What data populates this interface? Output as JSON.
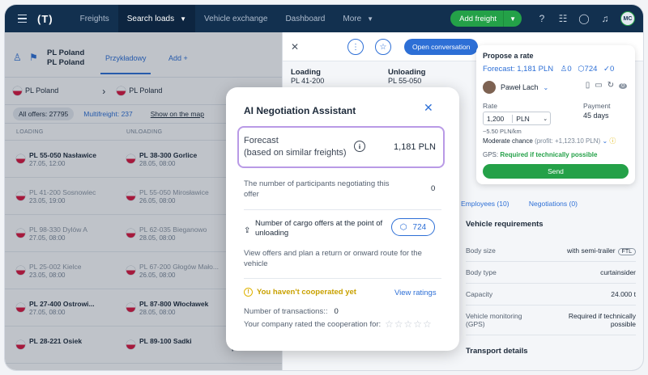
{
  "topnav": {
    "logo": "(T)",
    "items": [
      {
        "label": "Freights",
        "active": false
      },
      {
        "label": "Search loads",
        "active": true
      },
      {
        "label": "Vehicle exchange",
        "active": false
      },
      {
        "label": "Dashboard",
        "active": false
      },
      {
        "label": "More",
        "active": false
      }
    ],
    "add_freight": "Add freight",
    "avatar_initials": "MC"
  },
  "left_panel": {
    "route_from": "PL Poland",
    "route_to": "PL Poland",
    "tab_example": "Przykładowy",
    "tab_add": "Add +",
    "filter_from": "PL Poland",
    "filter_to": "PL Poland",
    "all_offers": "All offers: 27795",
    "multifreight": "Multifreight: 237",
    "show_map": "Show on the map",
    "col_loading": "LOADING",
    "col_unloading": "UNLOADING",
    "rows": [
      {
        "load": "PL 55-050 Nasławice",
        "load_date": "27.05, 12:00",
        "unload": "PL 38-300 Gorlice",
        "unload_date": "28.05, 08:00",
        "extra": "",
        "dim": false
      },
      {
        "load": "PL 41-200 Sosnowiec",
        "load_date": "23.05, 19:00",
        "unload": "PL 55-050 Mirosławice",
        "unload_date": "26.05, 08:00",
        "extra": "",
        "dim": true
      },
      {
        "load": "PL 98-330 Dylów A",
        "load_date": "27.05, 08:00",
        "unload": "PL 62-035 Bieganowo",
        "unload_date": "28.05, 08:00",
        "extra": "",
        "dim": true
      },
      {
        "load": "PL 25-002 Kielce",
        "load_date": "23.05, 08:00",
        "unload": "PL 67-200 Głogów Mało...",
        "unload_date": "26.05, 08:00",
        "extra": "",
        "dim": true
      },
      {
        "load": "PL 27-400 Ostrowi...",
        "load_date": "27.05, 08:00",
        "unload": "PL 87-800 Włocławek",
        "unload_date": "28.05, 08:00",
        "extra": "",
        "dim": false
      },
      {
        "load": "PL 28-221 Osiek",
        "load_date": "",
        "unload": "PL 89-100 Sadki",
        "unload_date": "",
        "extra": "24 t, mega, platform",
        "dim": false
      }
    ]
  },
  "detail": {
    "open_conversation": "Open conversation",
    "loading_label": "Loading",
    "loading_value": "PL 41-200",
    "unloading_label": "Unloading",
    "unloading_value": "PL 55-050",
    "tabs": [
      "Employees (10)",
      "Negotiations (0)"
    ],
    "vehicle_req_title": "Vehicle requirements",
    "requirements": [
      {
        "label": "Body size",
        "value": "with semi-trailer",
        "badge": "FTL"
      },
      {
        "label": "Body type",
        "value": "curtainsider",
        "badge": ""
      },
      {
        "label": "Capacity",
        "value": "24.000 t",
        "badge": ""
      },
      {
        "label": "Vehicle monitoring (GPS)",
        "value": "Required if technically possible",
        "badge": ""
      }
    ],
    "transport_details": "Transport details"
  },
  "rate_card": {
    "title": "Propose a rate",
    "forecast": "Forecast: 1,181 PLN",
    "stat_users": "0",
    "stat_offers": "724",
    "stat_done": "0",
    "user_name": "Paweł Lach",
    "badge_count": "0",
    "rate_label": "Rate",
    "rate_value": "1,200",
    "currency": "PLN",
    "payment_label": "Payment",
    "payment_value": "45 days",
    "per_km": "~5.50 PLN/km",
    "moderate": "Moderate chance",
    "moderate_note": "(profit: +1,123.10 PLN)",
    "gps_label": "GPS:",
    "gps_value": "Required if technically possible",
    "send": "Send"
  },
  "modal": {
    "title": "AI Negotiation Assistant",
    "forecast_label": "Forecast\n(based on similar freights)",
    "forecast_line1": "Forecast",
    "forecast_line2": "(based on similar freights)",
    "forecast_value": "1,181 PLN",
    "participants_label": "The number of participants negotiating this offer",
    "participants_value": "0",
    "cargo_label": "Number of cargo offers at the point of unloading",
    "cargo_value": "724",
    "view_offers": "View offers and plan a return or onward route for the vehicle",
    "warning": "You haven't cooperated yet",
    "view_ratings": "View ratings",
    "transactions_label": "Number of transactions::",
    "transactions_value": "0",
    "rated_label": "Your company rated the cooperation for:",
    "stars": "☆☆☆☆☆"
  }
}
